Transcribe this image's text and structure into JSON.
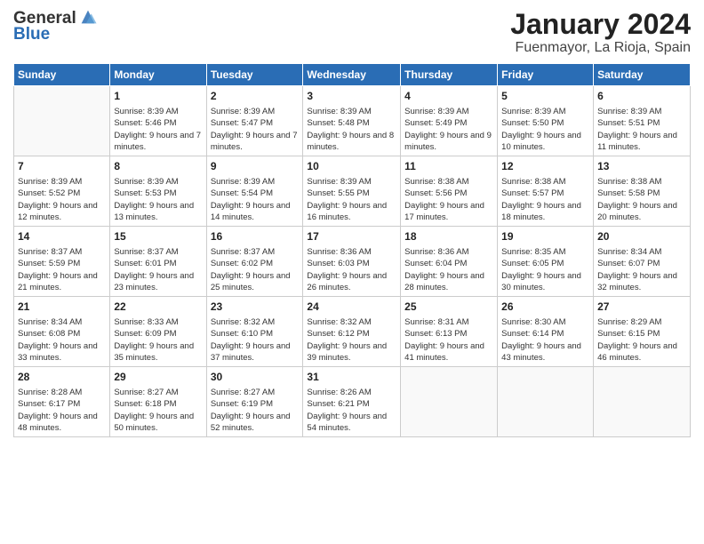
{
  "header": {
    "logo_line1": "General",
    "logo_line2": "Blue",
    "month": "January 2024",
    "location": "Fuenmayor, La Rioja, Spain"
  },
  "days_of_week": [
    "Sunday",
    "Monday",
    "Tuesday",
    "Wednesday",
    "Thursday",
    "Friday",
    "Saturday"
  ],
  "weeks": [
    [
      {
        "day": "",
        "sunrise": "",
        "sunset": "",
        "daylight": "",
        "empty": true
      },
      {
        "day": "1",
        "sunrise": "Sunrise: 8:39 AM",
        "sunset": "Sunset: 5:46 PM",
        "daylight": "Daylight: 9 hours and 7 minutes."
      },
      {
        "day": "2",
        "sunrise": "Sunrise: 8:39 AM",
        "sunset": "Sunset: 5:47 PM",
        "daylight": "Daylight: 9 hours and 7 minutes."
      },
      {
        "day": "3",
        "sunrise": "Sunrise: 8:39 AM",
        "sunset": "Sunset: 5:48 PM",
        "daylight": "Daylight: 9 hours and 8 minutes."
      },
      {
        "day": "4",
        "sunrise": "Sunrise: 8:39 AM",
        "sunset": "Sunset: 5:49 PM",
        "daylight": "Daylight: 9 hours and 9 minutes."
      },
      {
        "day": "5",
        "sunrise": "Sunrise: 8:39 AM",
        "sunset": "Sunset: 5:50 PM",
        "daylight": "Daylight: 9 hours and 10 minutes."
      },
      {
        "day": "6",
        "sunrise": "Sunrise: 8:39 AM",
        "sunset": "Sunset: 5:51 PM",
        "daylight": "Daylight: 9 hours and 11 minutes."
      }
    ],
    [
      {
        "day": "7",
        "sunrise": "Sunrise: 8:39 AM",
        "sunset": "Sunset: 5:52 PM",
        "daylight": "Daylight: 9 hours and 12 minutes."
      },
      {
        "day": "8",
        "sunrise": "Sunrise: 8:39 AM",
        "sunset": "Sunset: 5:53 PM",
        "daylight": "Daylight: 9 hours and 13 minutes."
      },
      {
        "day": "9",
        "sunrise": "Sunrise: 8:39 AM",
        "sunset": "Sunset: 5:54 PM",
        "daylight": "Daylight: 9 hours and 14 minutes."
      },
      {
        "day": "10",
        "sunrise": "Sunrise: 8:39 AM",
        "sunset": "Sunset: 5:55 PM",
        "daylight": "Daylight: 9 hours and 16 minutes."
      },
      {
        "day": "11",
        "sunrise": "Sunrise: 8:38 AM",
        "sunset": "Sunset: 5:56 PM",
        "daylight": "Daylight: 9 hours and 17 minutes."
      },
      {
        "day": "12",
        "sunrise": "Sunrise: 8:38 AM",
        "sunset": "Sunset: 5:57 PM",
        "daylight": "Daylight: 9 hours and 18 minutes."
      },
      {
        "day": "13",
        "sunrise": "Sunrise: 8:38 AM",
        "sunset": "Sunset: 5:58 PM",
        "daylight": "Daylight: 9 hours and 20 minutes."
      }
    ],
    [
      {
        "day": "14",
        "sunrise": "Sunrise: 8:37 AM",
        "sunset": "Sunset: 5:59 PM",
        "daylight": "Daylight: 9 hours and 21 minutes."
      },
      {
        "day": "15",
        "sunrise": "Sunrise: 8:37 AM",
        "sunset": "Sunset: 6:01 PM",
        "daylight": "Daylight: 9 hours and 23 minutes."
      },
      {
        "day": "16",
        "sunrise": "Sunrise: 8:37 AM",
        "sunset": "Sunset: 6:02 PM",
        "daylight": "Daylight: 9 hours and 25 minutes."
      },
      {
        "day": "17",
        "sunrise": "Sunrise: 8:36 AM",
        "sunset": "Sunset: 6:03 PM",
        "daylight": "Daylight: 9 hours and 26 minutes."
      },
      {
        "day": "18",
        "sunrise": "Sunrise: 8:36 AM",
        "sunset": "Sunset: 6:04 PM",
        "daylight": "Daylight: 9 hours and 28 minutes."
      },
      {
        "day": "19",
        "sunrise": "Sunrise: 8:35 AM",
        "sunset": "Sunset: 6:05 PM",
        "daylight": "Daylight: 9 hours and 30 minutes."
      },
      {
        "day": "20",
        "sunrise": "Sunrise: 8:34 AM",
        "sunset": "Sunset: 6:07 PM",
        "daylight": "Daylight: 9 hours and 32 minutes."
      }
    ],
    [
      {
        "day": "21",
        "sunrise": "Sunrise: 8:34 AM",
        "sunset": "Sunset: 6:08 PM",
        "daylight": "Daylight: 9 hours and 33 minutes."
      },
      {
        "day": "22",
        "sunrise": "Sunrise: 8:33 AM",
        "sunset": "Sunset: 6:09 PM",
        "daylight": "Daylight: 9 hours and 35 minutes."
      },
      {
        "day": "23",
        "sunrise": "Sunrise: 8:32 AM",
        "sunset": "Sunset: 6:10 PM",
        "daylight": "Daylight: 9 hours and 37 minutes."
      },
      {
        "day": "24",
        "sunrise": "Sunrise: 8:32 AM",
        "sunset": "Sunset: 6:12 PM",
        "daylight": "Daylight: 9 hours and 39 minutes."
      },
      {
        "day": "25",
        "sunrise": "Sunrise: 8:31 AM",
        "sunset": "Sunset: 6:13 PM",
        "daylight": "Daylight: 9 hours and 41 minutes."
      },
      {
        "day": "26",
        "sunrise": "Sunrise: 8:30 AM",
        "sunset": "Sunset: 6:14 PM",
        "daylight": "Daylight: 9 hours and 43 minutes."
      },
      {
        "day": "27",
        "sunrise": "Sunrise: 8:29 AM",
        "sunset": "Sunset: 6:15 PM",
        "daylight": "Daylight: 9 hours and 46 minutes."
      }
    ],
    [
      {
        "day": "28",
        "sunrise": "Sunrise: 8:28 AM",
        "sunset": "Sunset: 6:17 PM",
        "daylight": "Daylight: 9 hours and 48 minutes."
      },
      {
        "day": "29",
        "sunrise": "Sunrise: 8:27 AM",
        "sunset": "Sunset: 6:18 PM",
        "daylight": "Daylight: 9 hours and 50 minutes."
      },
      {
        "day": "30",
        "sunrise": "Sunrise: 8:27 AM",
        "sunset": "Sunset: 6:19 PM",
        "daylight": "Daylight: 9 hours and 52 minutes."
      },
      {
        "day": "31",
        "sunrise": "Sunrise: 8:26 AM",
        "sunset": "Sunset: 6:21 PM",
        "daylight": "Daylight: 9 hours and 54 minutes."
      },
      {
        "day": "",
        "sunrise": "",
        "sunset": "",
        "daylight": "",
        "empty": true
      },
      {
        "day": "",
        "sunrise": "",
        "sunset": "",
        "daylight": "",
        "empty": true
      },
      {
        "day": "",
        "sunrise": "",
        "sunset": "",
        "daylight": "",
        "empty": true
      }
    ]
  ]
}
